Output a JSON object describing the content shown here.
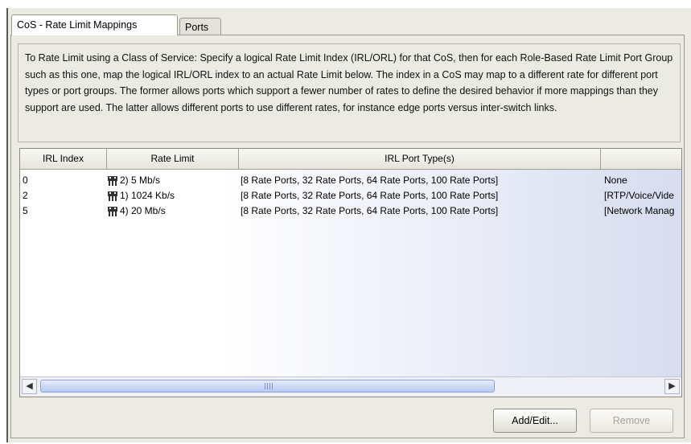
{
  "tabs": [
    {
      "label": "CoS - Rate Limit Mappings",
      "active": true
    },
    {
      "label": "Ports",
      "active": false
    }
  ],
  "description": "To Rate Limit using a Class of Service: Specify a logical Rate Limit Index (IRL/ORL) for that CoS, then for each Role-Based Rate Limit Port Group such as this one, map the logical IRL/ORL index to an actual Rate Limit below. The index in a CoS may map to a different rate for different port types or port groups.  The former allows ports which support a fewer number of rates to define the desired behavior if more mappings than they support are used. The latter allows different ports to use different rates, for instance edge ports versus inter-switch links.",
  "table": {
    "columns": [
      "IRL Index",
      "Rate Limit",
      "IRL Port Type(s)",
      ""
    ],
    "rows": [
      {
        "index": "0",
        "icon": "rate-limit-icon",
        "rate": "2) 5 Mb/s",
        "port_types": "[8 Rate Ports, 32 Rate Ports, 64 Rate Ports, 100 Rate Ports]",
        "extra": "None"
      },
      {
        "index": "2",
        "icon": "rate-limit-icon",
        "rate": "1) 1024 Kb/s",
        "port_types": "[8 Rate Ports, 32 Rate Ports, 64 Rate Ports, 100 Rate Ports]",
        "extra": "[RTP/Voice/Vide"
      },
      {
        "index": "5",
        "icon": "rate-limit-icon",
        "rate": "4) 20 Mb/s",
        "port_types": "[8 Rate Ports, 32 Rate Ports, 64 Rate Ports, 100 Rate Ports]",
        "extra": "[Network Manag"
      }
    ]
  },
  "buttons": {
    "add_edit": "Add/Edit...",
    "remove": "Remove"
  },
  "colors": {
    "panel_bg": "#ecebe3",
    "scroll_thumb": "#b7c8ef",
    "disabled_text": "#a7a59b"
  }
}
